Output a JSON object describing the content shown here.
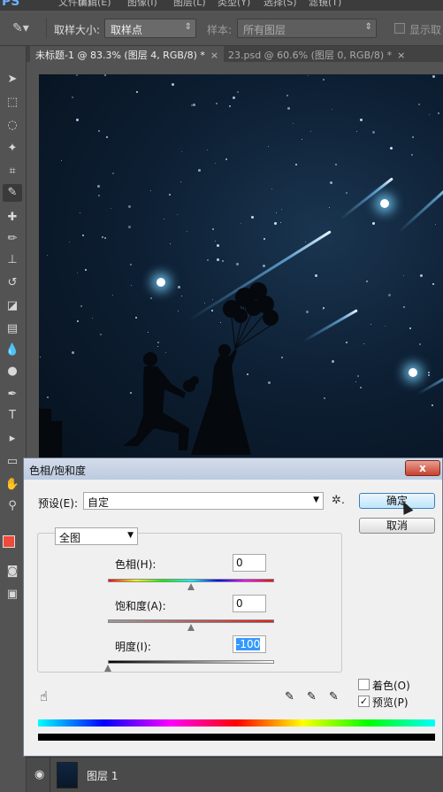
{
  "menubar": {
    "logo": "PS",
    "items": [
      "文件(F)",
      "编辑(E)",
      "图像(I)",
      "图层(L)",
      "类型(Y)",
      "选择(S)",
      "滤镜(T)"
    ]
  },
  "options_bar": {
    "sample_size_label": "取样大小:",
    "sample_size_value": "取样点",
    "sample_label": "样本:",
    "sample_value": "所有图层",
    "show_ring_label": "显示取"
  },
  "tabs": [
    {
      "label": "未标题-1 @ 83.3% (图层 4, RGB/8) *",
      "close": "×"
    },
    {
      "label": "23.psd @ 60.6% (图层 0, RGB/8) *",
      "close": "×"
    }
  ],
  "colors": {
    "foreground": "#f04a3a",
    "background": "#ffffff",
    "accent": "#3399ff"
  },
  "dialog": {
    "title": "色相/饱和度",
    "close": "x",
    "preset_label": "预设(E):",
    "preset_value": "自定",
    "ok_label": "确定",
    "cancel_label": "取消",
    "channel_value": "全图",
    "hue_label": "色相(H):",
    "hue_value": "0",
    "saturation_label": "饱和度(A):",
    "saturation_value": "0",
    "lightness_label": "明度(I):",
    "lightness_value": "-100",
    "colorize_label": "着色(O)",
    "colorize_checked": false,
    "preview_label": "预览(P)",
    "preview_checked": true,
    "preview_check_glyph": "✓"
  },
  "layers": {
    "layer_name": "图层 1"
  }
}
